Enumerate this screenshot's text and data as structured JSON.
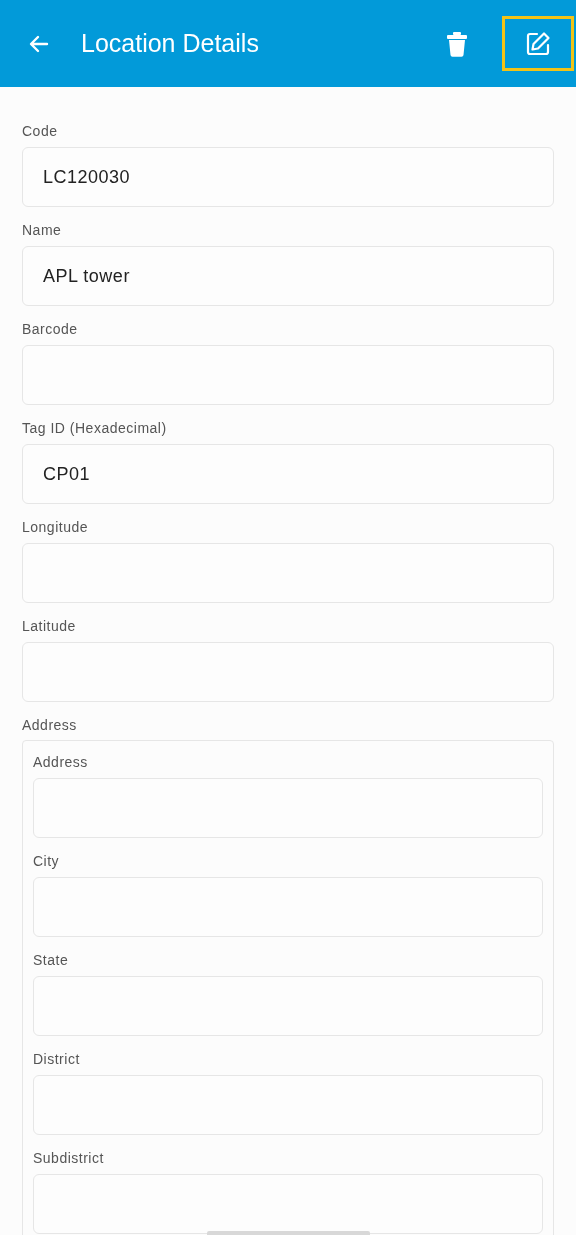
{
  "app_bar": {
    "title": "Location Details",
    "actions": [
      {
        "kind": "delete",
        "highlighted": false
      },
      {
        "kind": "edit",
        "highlighted": true
      }
    ]
  },
  "fields": [
    {
      "label": "Code",
      "value": "LC120030"
    },
    {
      "label": "Name",
      "value": "APL tower"
    },
    {
      "label": "Barcode"
    },
    {
      "label": "Tag ID (Hexadecimal)",
      "value": "CP01"
    },
    {
      "label": "Longitude"
    },
    {
      "label": "Latitude"
    }
  ],
  "address_group": {
    "label": "Address",
    "fields": [
      {
        "label": "Address"
      },
      {
        "label": "City"
      },
      {
        "label": "State"
      },
      {
        "label": "District"
      },
      {
        "label": "Subdistrict"
      }
    ]
  }
}
